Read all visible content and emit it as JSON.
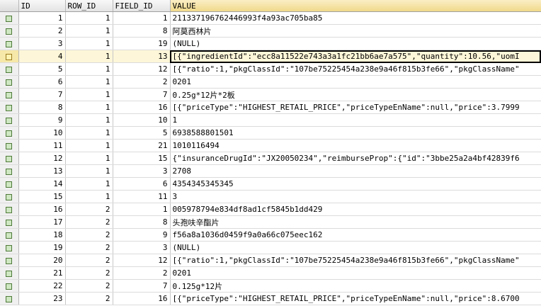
{
  "columns": [
    "ID",
    "ROW_ID",
    "FIELD_ID",
    "VALUE"
  ],
  "current_row_index": 3,
  "rows": [
    {
      "id": "1",
      "row_id": "1",
      "field_id": "1",
      "value": "211337196762446993f4a93ac705ba85"
    },
    {
      "id": "2",
      "row_id": "1",
      "field_id": "8",
      "value": "阿莫西林片"
    },
    {
      "id": "3",
      "row_id": "1",
      "field_id": "19",
      "value": "(NULL)"
    },
    {
      "id": "4",
      "row_id": "1",
      "field_id": "13",
      "value": "[{\"ingredientId\":\"ecc8a11522e743a3a1fc21bb6ae7a575\",\"quantity\":10.56,\"uomI"
    },
    {
      "id": "5",
      "row_id": "1",
      "field_id": "12",
      "value": "[{\"ratio\":1,\"pkgClassId\":\"107be75225454a238e9a46f815b3fe66\",\"pkgClassName\""
    },
    {
      "id": "6",
      "row_id": "1",
      "field_id": "2",
      "value": "0201"
    },
    {
      "id": "7",
      "row_id": "1",
      "field_id": "7",
      "value": "0.25g*12片*2板"
    },
    {
      "id": "8",
      "row_id": "1",
      "field_id": "16",
      "value": "[{\"priceType\":\"HIGHEST_RETAIL_PRICE\",\"priceTypeEnName\":null,\"price\":3.7999"
    },
    {
      "id": "9",
      "row_id": "1",
      "field_id": "10",
      "value": "1"
    },
    {
      "id": "10",
      "row_id": "1",
      "field_id": "5",
      "value": "6938588801501"
    },
    {
      "id": "11",
      "row_id": "1",
      "field_id": "21",
      "value": "1010116494"
    },
    {
      "id": "12",
      "row_id": "1",
      "field_id": "15",
      "value": "{\"insuranceDrugId\":\"JX20050234\",\"reimburseProp\":{\"id\":\"3bbe25a2a4bf42839f6"
    },
    {
      "id": "13",
      "row_id": "1",
      "field_id": "3",
      "value": "2708"
    },
    {
      "id": "14",
      "row_id": "1",
      "field_id": "6",
      "value": "4354345345345"
    },
    {
      "id": "15",
      "row_id": "1",
      "field_id": "11",
      "value": "3"
    },
    {
      "id": "16",
      "row_id": "2",
      "field_id": "1",
      "value": "005978794e834df8ad1cf5845b1dd429"
    },
    {
      "id": "17",
      "row_id": "2",
      "field_id": "8",
      "value": "头孢呋辛酯片"
    },
    {
      "id": "18",
      "row_id": "2",
      "field_id": "9",
      "value": "f56a8a1036d0459f9a0a66c075eec162"
    },
    {
      "id": "19",
      "row_id": "2",
      "field_id": "3",
      "value": "(NULL)"
    },
    {
      "id": "20",
      "row_id": "2",
      "field_id": "12",
      "value": "[{\"ratio\":1,\"pkgClassId\":\"107be75225454a238e9a46f815b3fe66\",\"pkgClassName\""
    },
    {
      "id": "21",
      "row_id": "2",
      "field_id": "2",
      "value": "0201"
    },
    {
      "id": "22",
      "row_id": "2",
      "field_id": "7",
      "value": "0.125g*12片"
    },
    {
      "id": "23",
      "row_id": "2",
      "field_id": "16",
      "value": "[{\"priceType\":\"HIGHEST_RETAIL_PRICE\",\"priceTypeEnName\":null,\"price\":8.6700"
    }
  ]
}
